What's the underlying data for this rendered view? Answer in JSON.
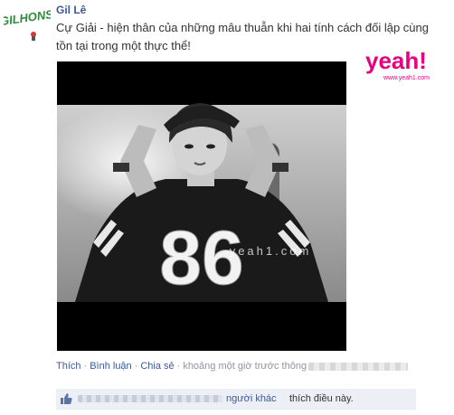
{
  "post": {
    "author": "Gil Lê",
    "status_text": "Cự Giải - hiện thân của những mâu thuẫn khi hai tính cách đối lập cùng tồn tại trong một thực thể!",
    "avatar_logo_text": "GILHONS",
    "watermark": "yeah1.com"
  },
  "brand": {
    "logo_text": "yeah!",
    "logo_subtext": "www.yeah1.com",
    "color": "#e6007e"
  },
  "photo": {
    "jersey_number": "86"
  },
  "actions": {
    "like": "Thích",
    "comment": "Bình luận",
    "share": "Chia sẻ",
    "separator": "·",
    "timestamp": "khoảng một giờ trước thông"
  },
  "likes": {
    "others_link": "người khác",
    "suffix": "thích điều này."
  },
  "colors": {
    "link": "#3b5998",
    "like_bar": "#eceff5",
    "muted": "#90949c"
  },
  "icons": [
    "thumbs-up-icon"
  ]
}
